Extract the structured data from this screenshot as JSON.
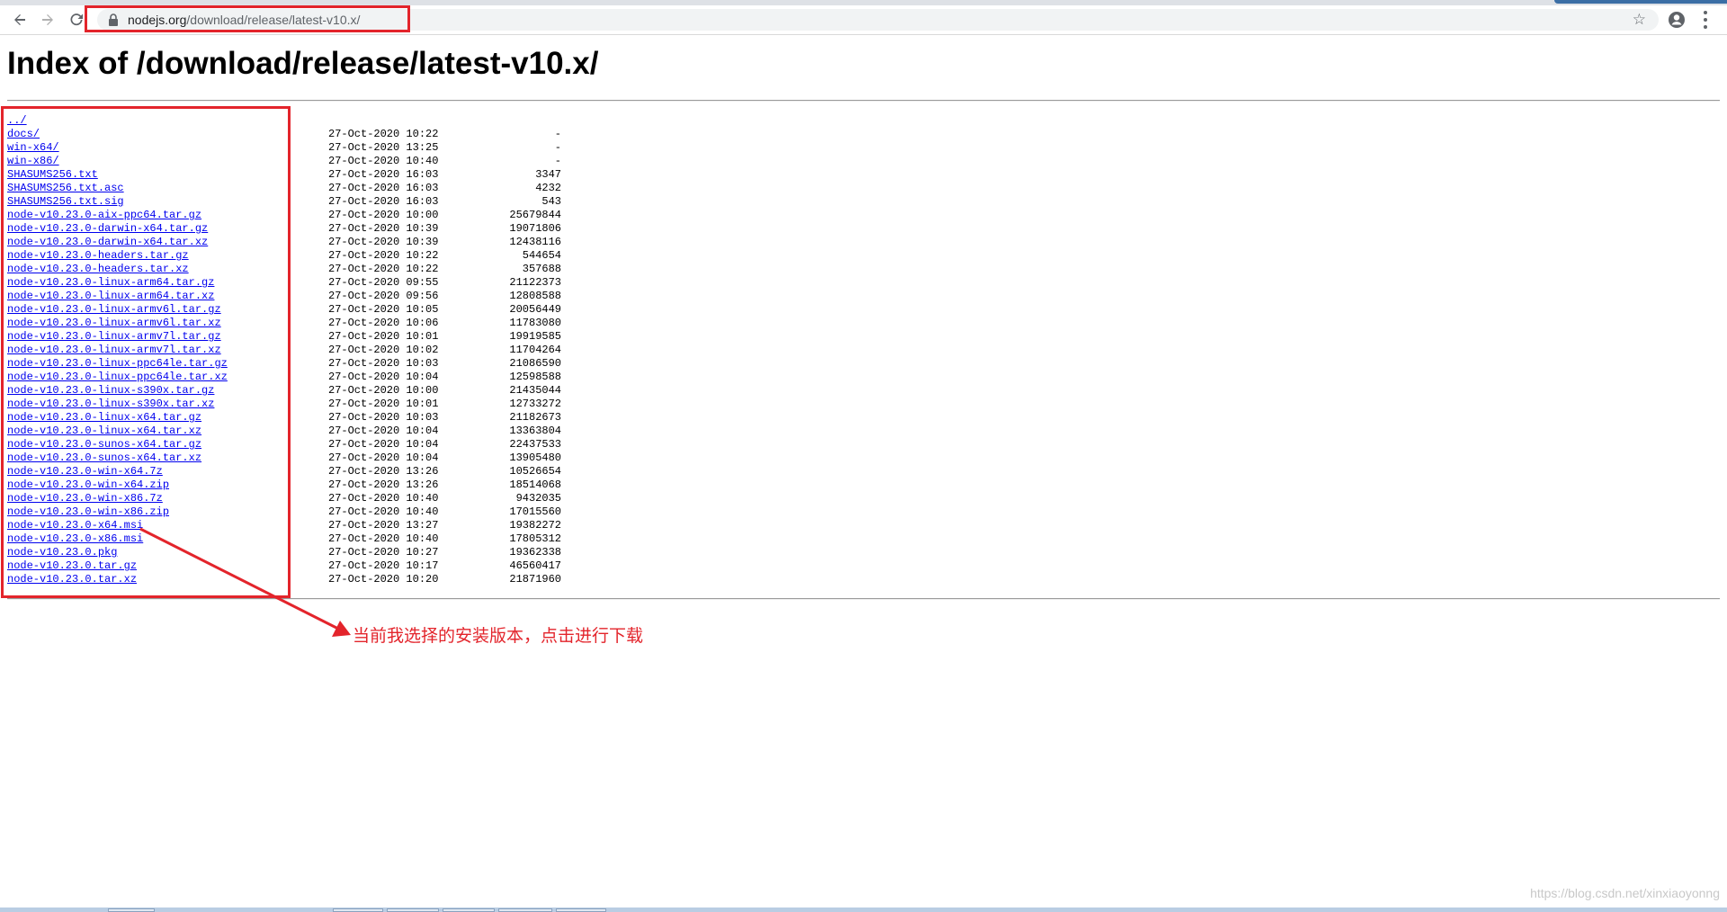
{
  "browser": {
    "url_host": "nodejs.org",
    "url_path": "/download/release/latest-v10.x/",
    "back_icon": "arrow-left-icon",
    "forward_icon": "arrow-right-icon",
    "reload_icon": "reload-icon",
    "lock_icon": "lock-icon",
    "bookmark_icon": "star-icon",
    "profile_icon": "account-circle-icon",
    "menu_icon": "kebab-menu-icon"
  },
  "page": {
    "title": "Index of /download/release/latest-v10.x/",
    "entries": [
      {
        "name": "../",
        "date": "",
        "size": ""
      },
      {
        "name": "docs/",
        "date": "27-Oct-2020 10:22",
        "size": "-"
      },
      {
        "name": "win-x64/",
        "date": "27-Oct-2020 13:25",
        "size": "-"
      },
      {
        "name": "win-x86/",
        "date": "27-Oct-2020 10:40",
        "size": "-"
      },
      {
        "name": "SHASUMS256.txt",
        "date": "27-Oct-2020 16:03",
        "size": "3347"
      },
      {
        "name": "SHASUMS256.txt.asc",
        "date": "27-Oct-2020 16:03",
        "size": "4232"
      },
      {
        "name": "SHASUMS256.txt.sig",
        "date": "27-Oct-2020 16:03",
        "size": "543"
      },
      {
        "name": "node-v10.23.0-aix-ppc64.tar.gz",
        "date": "27-Oct-2020 10:00",
        "size": "25679844"
      },
      {
        "name": "node-v10.23.0-darwin-x64.tar.gz",
        "date": "27-Oct-2020 10:39",
        "size": "19071806"
      },
      {
        "name": "node-v10.23.0-darwin-x64.tar.xz",
        "date": "27-Oct-2020 10:39",
        "size": "12438116"
      },
      {
        "name": "node-v10.23.0-headers.tar.gz",
        "date": "27-Oct-2020 10:22",
        "size": "544654"
      },
      {
        "name": "node-v10.23.0-headers.tar.xz",
        "date": "27-Oct-2020 10:22",
        "size": "357688"
      },
      {
        "name": "node-v10.23.0-linux-arm64.tar.gz",
        "date": "27-Oct-2020 09:55",
        "size": "21122373"
      },
      {
        "name": "node-v10.23.0-linux-arm64.tar.xz",
        "date": "27-Oct-2020 09:56",
        "size": "12808588"
      },
      {
        "name": "node-v10.23.0-linux-armv6l.tar.gz",
        "date": "27-Oct-2020 10:05",
        "size": "20056449"
      },
      {
        "name": "node-v10.23.0-linux-armv6l.tar.xz",
        "date": "27-Oct-2020 10:06",
        "size": "11783080"
      },
      {
        "name": "node-v10.23.0-linux-armv7l.tar.gz",
        "date": "27-Oct-2020 10:01",
        "size": "19919585"
      },
      {
        "name": "node-v10.23.0-linux-armv7l.tar.xz",
        "date": "27-Oct-2020 10:02",
        "size": "11704264"
      },
      {
        "name": "node-v10.23.0-linux-ppc64le.tar.gz",
        "date": "27-Oct-2020 10:03",
        "size": "21086590"
      },
      {
        "name": "node-v10.23.0-linux-ppc64le.tar.xz",
        "date": "27-Oct-2020 10:04",
        "size": "12598588"
      },
      {
        "name": "node-v10.23.0-linux-s390x.tar.gz",
        "date": "27-Oct-2020 10:00",
        "size": "21435044"
      },
      {
        "name": "node-v10.23.0-linux-s390x.tar.xz",
        "date": "27-Oct-2020 10:01",
        "size": "12733272"
      },
      {
        "name": "node-v10.23.0-linux-x64.tar.gz",
        "date": "27-Oct-2020 10:03",
        "size": "21182673"
      },
      {
        "name": "node-v10.23.0-linux-x64.tar.xz",
        "date": "27-Oct-2020 10:04",
        "size": "13363804"
      },
      {
        "name": "node-v10.23.0-sunos-x64.tar.gz",
        "date": "27-Oct-2020 10:04",
        "size": "22437533"
      },
      {
        "name": "node-v10.23.0-sunos-x64.tar.xz",
        "date": "27-Oct-2020 10:04",
        "size": "13905480"
      },
      {
        "name": "node-v10.23.0-win-x64.7z",
        "date": "27-Oct-2020 13:26",
        "size": "10526654"
      },
      {
        "name": "node-v10.23.0-win-x64.zip",
        "date": "27-Oct-2020 13:26",
        "size": "18514068"
      },
      {
        "name": "node-v10.23.0-win-x86.7z",
        "date": "27-Oct-2020 10:40",
        "size": "9432035"
      },
      {
        "name": "node-v10.23.0-win-x86.zip",
        "date": "27-Oct-2020 10:40",
        "size": "17015560"
      },
      {
        "name": "node-v10.23.0-x64.msi",
        "date": "27-Oct-2020 13:27",
        "size": "19382272"
      },
      {
        "name": "node-v10.23.0-x86.msi",
        "date": "27-Oct-2020 10:40",
        "size": "17805312"
      },
      {
        "name": "node-v10.23.0.pkg",
        "date": "27-Oct-2020 10:27",
        "size": "19362338"
      },
      {
        "name": "node-v10.23.0.tar.gz",
        "date": "27-Oct-2020 10:17",
        "size": "46560417"
      },
      {
        "name": "node-v10.23.0.tar.xz",
        "date": "27-Oct-2020 10:20",
        "size": "21871960"
      }
    ]
  },
  "annotation": {
    "text": "当前我选择的安装版本，点击进行下载",
    "color": "#e3242b"
  },
  "watermark": "https://blog.csdn.net/xinxiaoyonng"
}
